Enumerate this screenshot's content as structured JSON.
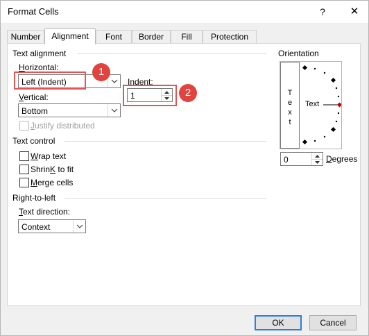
{
  "window": {
    "title": "Format Cells",
    "help_glyph": "?",
    "close_glyph": "✕"
  },
  "tabs": [
    {
      "label": "Number"
    },
    {
      "label": "Alignment",
      "active": true
    },
    {
      "label": "Font"
    },
    {
      "label": "Border"
    },
    {
      "label": "Fill"
    },
    {
      "label": "Protection"
    }
  ],
  "text_alignment": {
    "title": "Text alignment",
    "horizontal": {
      "label_key": "H",
      "label_rest": "orizontal:",
      "value": "Left (Indent)"
    },
    "indent": {
      "label_key": "I",
      "label_rest": "ndent:",
      "value": "1"
    },
    "vertical": {
      "label_key": "V",
      "label_rest": "ertical:",
      "value": "Bottom"
    },
    "justify_distributed": {
      "label_key": "J",
      "label_rest": "ustify distributed",
      "checked": false,
      "enabled": false
    }
  },
  "text_control": {
    "title": "Text control",
    "wrap_text": {
      "label_key": "W",
      "label_rest": "rap text",
      "checked": false
    },
    "shrink_to_fit": {
      "label_key": "K",
      "label_rest": "Shrin",
      "label_after": " to fit",
      "checked": false
    },
    "merge_cells": {
      "label_key": "M",
      "label_rest": "erge cells",
      "checked": false
    }
  },
  "right_to_left": {
    "title": "Right-to-left",
    "text_direction": {
      "label_key": "T",
      "label_rest": "ext direction:",
      "value": "Context"
    }
  },
  "orientation": {
    "title": "Orientation",
    "vertical_text": [
      "T",
      "e",
      "x",
      "t"
    ],
    "dial_label": "Text",
    "degrees_value": "0",
    "degrees_label_key": "D",
    "degrees_label_rest": "egrees"
  },
  "annotations": [
    {
      "number": "1",
      "color": "#e0443f"
    },
    {
      "number": "2",
      "color": "#e0443f"
    }
  ],
  "buttons": {
    "ok": "OK",
    "cancel": "Cancel"
  },
  "colors": {
    "highlight": "#e25555",
    "default_button_border": "#2a7de1",
    "dial_pointer": "#c00000"
  }
}
